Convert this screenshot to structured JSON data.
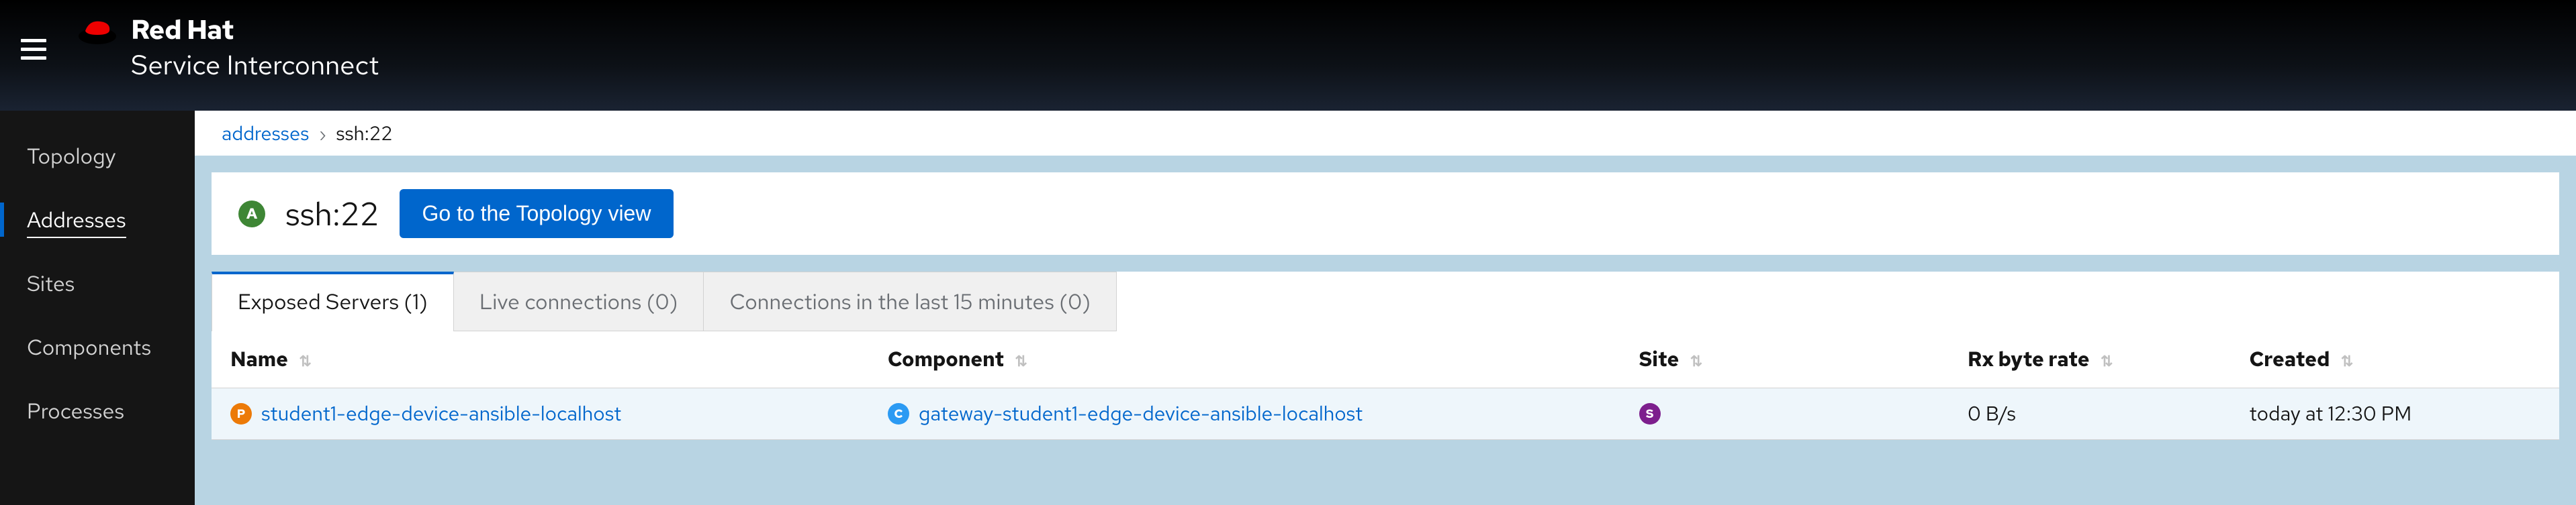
{
  "brand": {
    "line1": "Red Hat",
    "line2": "Service Interconnect"
  },
  "nav": {
    "items": [
      {
        "label": "Topology",
        "active": false
      },
      {
        "label": "Addresses",
        "active": true
      },
      {
        "label": "Sites",
        "active": false
      },
      {
        "label": "Components",
        "active": false
      },
      {
        "label": "Processes",
        "active": false
      }
    ]
  },
  "breadcrumb": {
    "parent": "addresses",
    "sep": "›",
    "current": "ssh:22"
  },
  "page": {
    "badge_letter": "A",
    "title": "ssh:22",
    "topology_button": "Go to the Topology view"
  },
  "tabs": [
    {
      "label": "Exposed Servers (1)",
      "active": true
    },
    {
      "label": "Live connections (0)",
      "active": false
    },
    {
      "label": "Connections in the last 15 minutes (0)",
      "active": false
    }
  ],
  "table": {
    "columns": [
      {
        "key": "name",
        "label": "Name"
      },
      {
        "key": "component",
        "label": "Component"
      },
      {
        "key": "site",
        "label": "Site"
      },
      {
        "key": "rx",
        "label": "Rx byte rate"
      },
      {
        "key": "created",
        "label": "Created"
      }
    ],
    "rows": [
      {
        "name_badge": "P",
        "name": "student1-edge-device-ansible-localhost",
        "component_badge": "C",
        "component": "gateway-student1-edge-device-ansible-localhost",
        "site_badge": "S",
        "site": "",
        "rx": "0 B/s",
        "created": "today at 12:30 PM"
      }
    ]
  }
}
